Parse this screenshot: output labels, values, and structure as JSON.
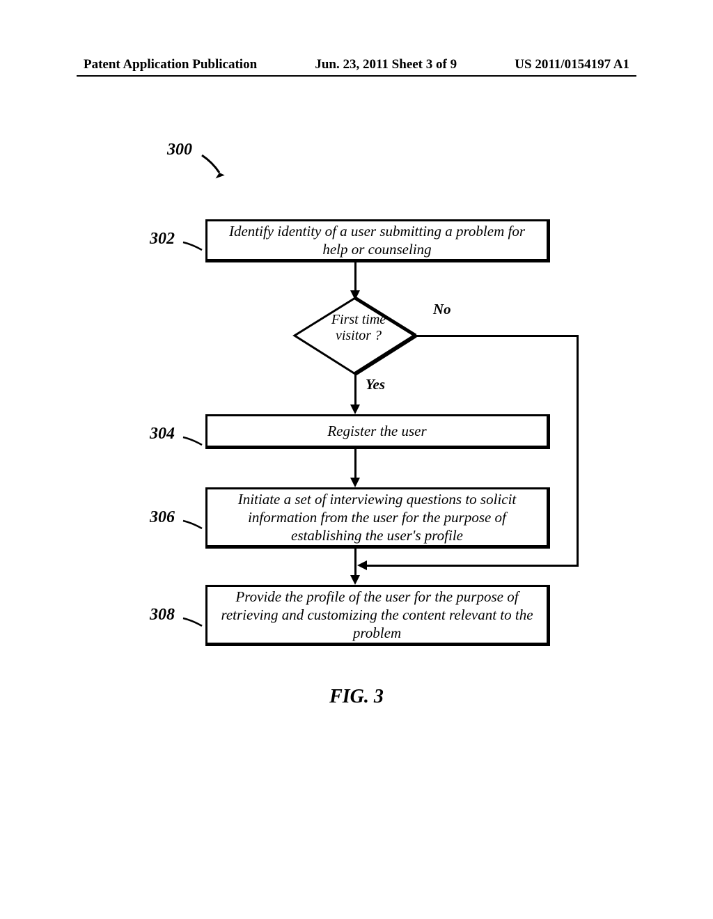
{
  "header": {
    "left": "Patent Application Publication",
    "center": "Jun. 23, 2011  Sheet 3 of 9",
    "right": "US 2011/0154197 A1"
  },
  "refs": {
    "r300": "300",
    "r302": "302",
    "r304": "304",
    "r306": "306",
    "r308": "308"
  },
  "boxes": {
    "b302": "Identify identity of a user submitting a problem for help or counseling",
    "b304": "Register the user",
    "b306": "Initiate a set of interviewing questions to solicit information from the user for the purpose of establishing the user's profile",
    "b308": "Provide the profile of the user for the purpose of retrieving and customizing the content relevant to the problem"
  },
  "decision": {
    "text": "First time visitor ?",
    "yes": "Yes",
    "no": "No"
  },
  "figure": "FIG. 3",
  "chart_data": {
    "type": "flowchart",
    "title": "FIG. 3",
    "reference_number": "300",
    "nodes": [
      {
        "id": "302",
        "type": "process",
        "text": "Identify identity of a user submitting a problem for help or counseling"
      },
      {
        "id": "decision",
        "type": "decision",
        "text": "First time visitor ?"
      },
      {
        "id": "304",
        "type": "process",
        "text": "Register the user"
      },
      {
        "id": "306",
        "type": "process",
        "text": "Initiate a set of interviewing questions to solicit information from the user for the purpose of establishing the user's profile"
      },
      {
        "id": "308",
        "type": "process",
        "text": "Provide the profile of the user for the purpose of retrieving and customizing the content relevant to the problem"
      }
    ],
    "edges": [
      {
        "from": "302",
        "to": "decision"
      },
      {
        "from": "decision",
        "to": "304",
        "label": "Yes"
      },
      {
        "from": "decision",
        "to": "308",
        "label": "No"
      },
      {
        "from": "304",
        "to": "306"
      },
      {
        "from": "306",
        "to": "308"
      }
    ]
  }
}
